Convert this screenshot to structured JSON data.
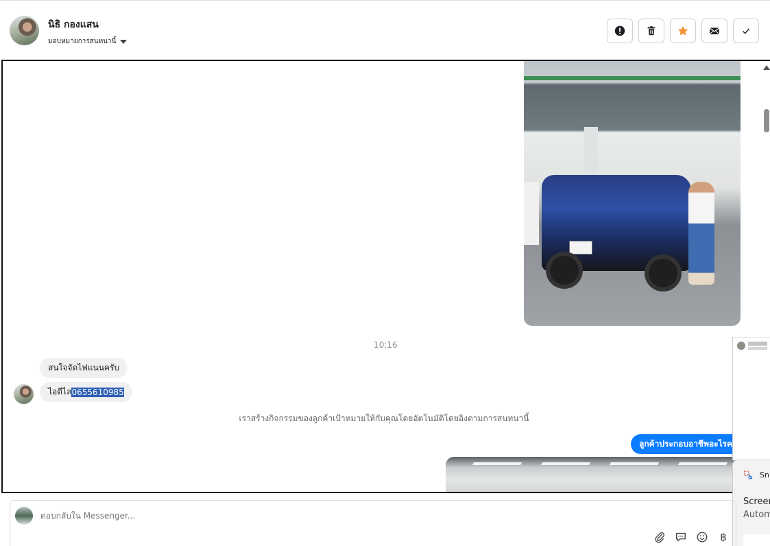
{
  "header": {
    "contact_name": "นิธิ กองแสน",
    "assign_label": "มอบหมายการสนทนานี้"
  },
  "actions": [
    {
      "name": "report-button",
      "icon": "exclamation-circle-icon"
    },
    {
      "name": "delete-button",
      "icon": "trash-icon"
    },
    {
      "name": "star-button",
      "icon": "star-icon",
      "color": "#f7923a"
    },
    {
      "name": "mark-unread-button",
      "icon": "envelope-icon"
    },
    {
      "name": "mark-done-button",
      "icon": "check-icon"
    }
  ],
  "messages": {
    "timestamp": "10:16",
    "incoming": [
      {
        "text": "สนใจจัดไฟแนนครับ"
      },
      {
        "prefix": "ไอดีไล",
        "highlighted": "0655610985"
      }
    ],
    "system_note": "เราสร้างกิจกรรมของลูกค้าเป้าหมายให้กับคุณโดยอัตโนมัติโดยอิงตามการสนทนานี้",
    "outgoing": [
      {
        "text": "ลูกค้าประกอบอาชีพอะไรคะ"
      }
    ]
  },
  "snip_panel": {
    "title": "Sni",
    "line1": "Screen",
    "line2": "Autom"
  },
  "composer": {
    "placeholder": "ตอบกลับใน Messenger...",
    "tools": [
      "paperclip-icon",
      "chat-bubble-icon",
      "emoji-icon",
      "baht-icon"
    ],
    "baht_symbol": "฿"
  },
  "colors": {
    "outgoing_bubble": "#0a7cff",
    "selection_highlight": "#2d5fb5",
    "star": "#f7923a"
  }
}
